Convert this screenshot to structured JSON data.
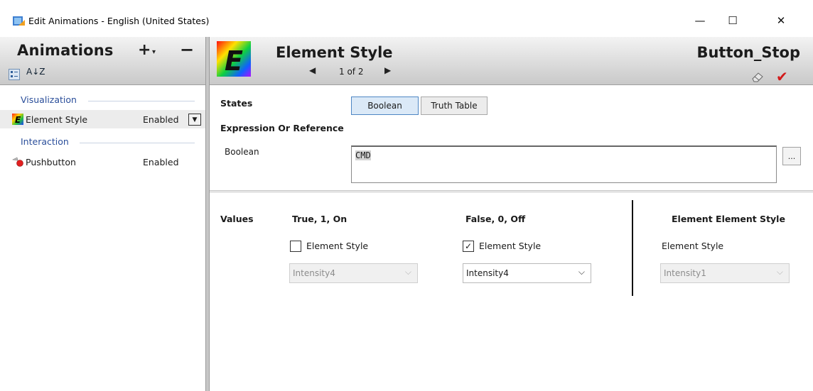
{
  "window": {
    "title": "Edit Animations - English (United States)",
    "minimize": "—",
    "maximize": "☐",
    "close": "✕"
  },
  "left_panel": {
    "title": "Animations",
    "add_symbol": "+",
    "add_dropdown_symbol": "▾",
    "remove_symbol": "−",
    "sort_symbol": "A↓Z",
    "groups": [
      {
        "label": "Visualization"
      },
      {
        "label": "Interaction"
      }
    ],
    "items": [
      {
        "name": "Element Style",
        "state": "Enabled",
        "icon": "element-style-icon",
        "selected": true
      },
      {
        "name": "Pushbutton",
        "state": "Enabled",
        "icon": "pushbutton-icon",
        "selected": false
      }
    ]
  },
  "header": {
    "title": "Element Style",
    "big_icon_letter": "E",
    "pager": "1 of 2",
    "prev_symbol": "◀",
    "next_symbol": "▶",
    "object_name": "Button_Stop",
    "validate_symbol": "✔"
  },
  "states": {
    "label": "States",
    "options": [
      "Boolean",
      "Truth Table"
    ],
    "active": "Boolean"
  },
  "expression": {
    "label": "Expression Or Reference",
    "field_label": "Boolean",
    "value": "CMD",
    "browse": "..."
  },
  "values": {
    "label": "Values",
    "columns": [
      {
        "header": "True, 1, On",
        "checkbox_label": "Element Style",
        "checked": false,
        "checkmark": "",
        "selection": "Intensity4",
        "enabled": false
      },
      {
        "header": "False, 0, Off",
        "checkbox_label": "Element Style",
        "checked": true,
        "checkmark": "✓",
        "selection": "Intensity4",
        "enabled": true
      }
    ],
    "element_column": {
      "header": "Element Element Style",
      "label": "Element Style",
      "selection": "Intensity1",
      "enabled": false
    },
    "combo_arrow": "⌵"
  }
}
